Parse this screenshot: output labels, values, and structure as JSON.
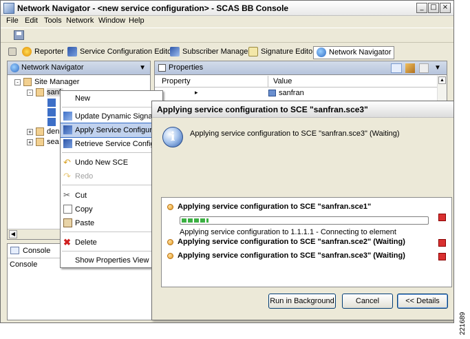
{
  "window": {
    "title": "Network Navigator - <new service configuration> - SCAS BB Console",
    "min": "_",
    "max": "□",
    "close": "×"
  },
  "menubar": [
    "File",
    "Edit",
    "Tools",
    "Network",
    "Window",
    "Help"
  ],
  "perspectives": [
    {
      "label": "Reporter",
      "icon": "reporter-icon"
    },
    {
      "label": "Service Configuration Editor",
      "icon": "service-config-icon"
    },
    {
      "label": "Subscriber Manager",
      "icon": "subscriber-icon"
    },
    {
      "label": "Signature Editor",
      "icon": "signature-icon"
    },
    {
      "label": "Network Navigator",
      "icon": "globe-icon",
      "active": true
    }
  ],
  "navigator": {
    "title": "Network Navigator",
    "tree": {
      "root": "Site Manager",
      "child1": "sanfr",
      "child2": "den",
      "child3": "sea"
    }
  },
  "properties": {
    "title": "Properties",
    "col_property": "Property",
    "col_value": "Value",
    "row1_value": "sanfran"
  },
  "context_menu": {
    "items": {
      "new": "New",
      "update": "Update Dynamic Signatures",
      "apply": "Apply Service Configuration",
      "retrieve": "Retrieve Service Configuration",
      "undo": "Undo New SCE",
      "redo": "Redo",
      "cut": "Cut",
      "copy": "Copy",
      "paste": "Paste",
      "delete": "Delete",
      "show": "Show Properties View"
    }
  },
  "console": {
    "tab": "Console",
    "label": "Console"
  },
  "dialog": {
    "title": "Applying service configuration to SCE \"sanfran.sce3\"",
    "message": "Applying service configuration to SCE \"sanfran.sce3\" (Waiting)",
    "jobs": [
      {
        "label": "Applying service configuration to SCE \"sanfran.sce1\"",
        "progress": 0.11,
        "status": "Applying service configuration to 1.1.1.1 - Connecting to element"
      },
      {
        "label": "Applying service configuration to SCE \"sanfran.sce2\" (Waiting)"
      },
      {
        "label": "Applying service configuration to SCE \"sanfran.sce3\" (Waiting)"
      }
    ],
    "buttons": {
      "background": "Run in Background",
      "cancel": "Cancel",
      "details": "<< Details"
    }
  },
  "figure_id": "221689",
  "colors": {
    "accent": "#316ac5",
    "progress": "#3cb043",
    "stop": "#d93030"
  }
}
